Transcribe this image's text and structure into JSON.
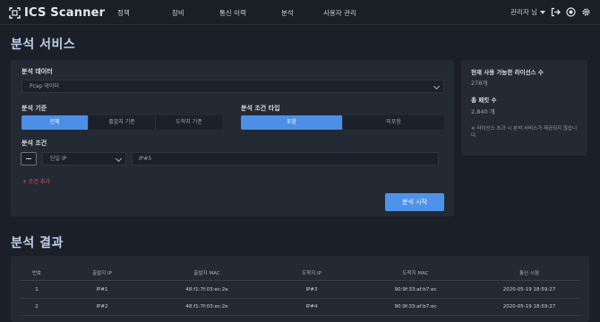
{
  "app": {
    "title": "ICS Scanner"
  },
  "nav": {
    "items": [
      "정책",
      "장비",
      "통신 이력",
      "분석",
      "사용자 관리"
    ],
    "user": "관리자 님"
  },
  "analysis": {
    "title": "분석 서비스",
    "data_label": "분석 데이터",
    "data_select": "Pcap 데이터",
    "criteria_label": "분석 기준",
    "criteria_options": [
      "전체",
      "출발지 기준",
      "도착지 기준"
    ],
    "criteria_selected": "전체",
    "cond_type_label": "분석 조건 타입",
    "cond_type_options": [
      "포함",
      "미포함"
    ],
    "cond_type_selected": "포함",
    "cond_label": "분석 조건",
    "cond_field_select": "단일 IP",
    "cond_value": "IP#5",
    "add_condition": "+ 조건 추가",
    "start_button": "분석 시작"
  },
  "license": {
    "available_label": "현재 사용 가능한 라이선스 수",
    "available_value": "278개",
    "total_label": "총 패킷 수",
    "total_value": "2,840 개",
    "note": "※ 라이선스 초과 시 분석 서비스가 제공되지 않습니다."
  },
  "result": {
    "title": "분석 결과",
    "columns": [
      "번호",
      "출발지 IP",
      "출발지 MAC",
      "도착지 IP",
      "도착지 MAC",
      "통신 시점"
    ],
    "rows": [
      [
        "1",
        "IP#1",
        "48:f1:7f:03:ec:2e",
        "IP#3",
        "90:9f:33:af:b7:ec",
        "2020-05-19 18:59:27"
      ],
      [
        "2",
        "IP#2",
        "48:f1:7f:03:ec:2e",
        "IP#4",
        "90:9f:33:af:b7:ec",
        "2020-05-19 18:59:27"
      ]
    ]
  },
  "colors": {
    "accent": "#4b8fe6",
    "background": "#1b1f27",
    "panel": "#242a34",
    "danger": "#e0564a"
  },
  "icons": [
    "scan-frame-icon",
    "chevron-down-icon",
    "logout-icon",
    "record-icon",
    "gear-icon"
  ]
}
